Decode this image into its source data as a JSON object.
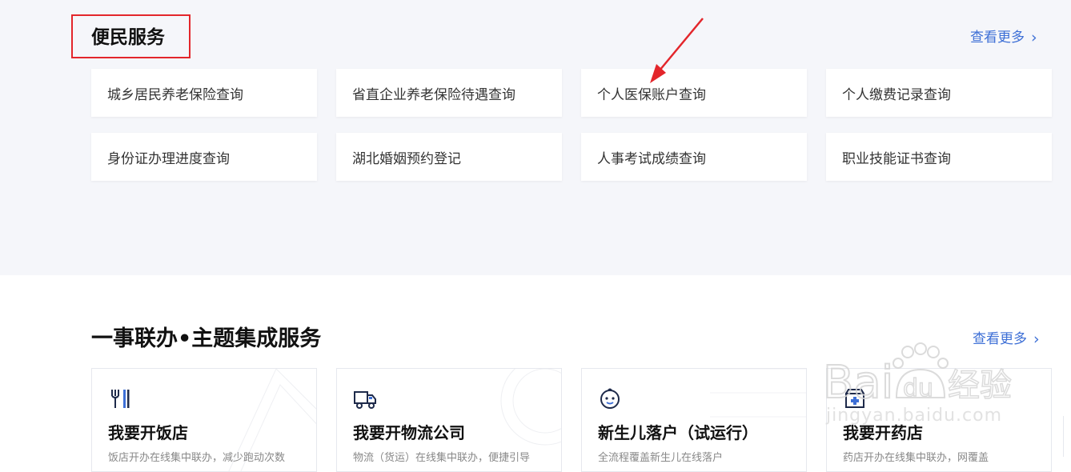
{
  "convenience": {
    "title": "便民服务",
    "more": "查看更多",
    "items": [
      "城乡居民养老保险查询",
      "省直企业养老保险待遇查询",
      "个人医保账户查询",
      "个人缴费记录查询",
      "身份证办理进度查询",
      "湖北婚姻预约登记",
      "人事考试成绩查询",
      "职业技能证书查询"
    ]
  },
  "integrated": {
    "title": "一事联办•主题集成服务",
    "more": "查看更多",
    "cards": [
      {
        "title": "我要开饭店",
        "desc": "饭店开办在线集中联办，减少跑动次数",
        "icon": "fork-knife-icon"
      },
      {
        "title": "我要开物流公司",
        "desc": "物流（货运）在线集中联办，便捷引导",
        "icon": "truck-icon"
      },
      {
        "title": "新生儿落户（试运行）",
        "desc": "全流程覆盖新生儿在线落户",
        "icon": "baby-face-icon"
      },
      {
        "title": "我要开药店",
        "desc": "药店开办在线集中联办，网覆盖",
        "icon": "pharmacy-icon"
      }
    ]
  },
  "watermark": {
    "brand": "Baidu经验",
    "url": "jingyan.baidu.com"
  },
  "colors": {
    "annotation": "#e3262b",
    "link": "#3d6fd6",
    "background": "#f5f6fa"
  }
}
